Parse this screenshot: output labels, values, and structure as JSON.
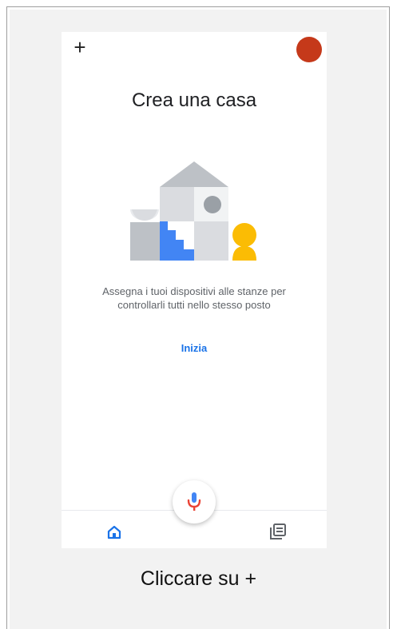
{
  "header": {
    "add_symbol": "+",
    "avatar_color": "#c5391a"
  },
  "main": {
    "title": "Crea una casa",
    "description_line1": "Assegna i tuoi dispositivi alle stanze per",
    "description_line2": "controllarli tutti nello stesso posto",
    "start_label": "Inizia"
  },
  "colors": {
    "accent": "#1a73e8",
    "mic_red": "#ea4335",
    "mic_blue": "#4285f4"
  },
  "icons": {
    "home": "home-icon",
    "feed": "feed-icon",
    "mic": "microphone-icon"
  },
  "caption": "Cliccare su +"
}
